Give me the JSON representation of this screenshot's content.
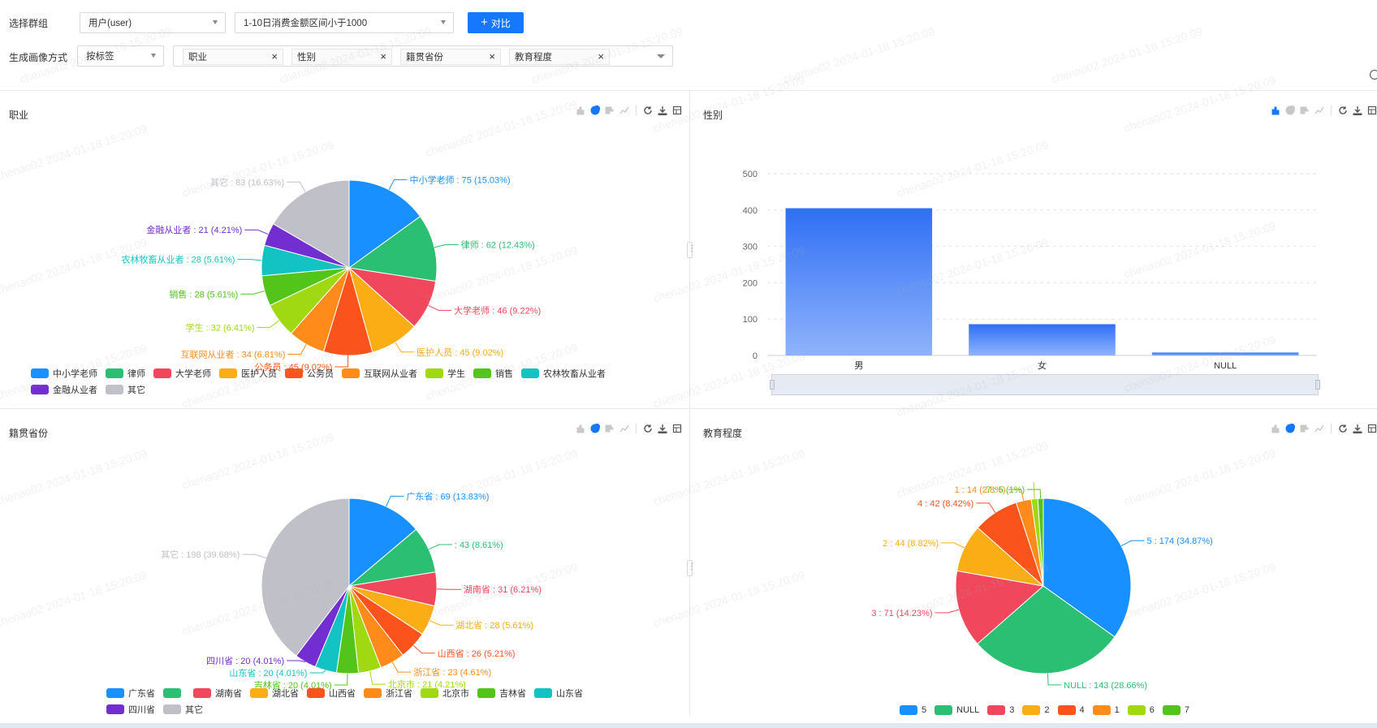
{
  "filters": {
    "group_label": "选择群组",
    "group_select": "用户(user)",
    "condition_select": "1-10日消费金额区间小于1000",
    "compare_label": "对比",
    "method_label": "生成画像方式",
    "method_select": "按标签",
    "tags": [
      "职业",
      "性别",
      "籍贯省份",
      "教育程度"
    ]
  },
  "watermark": "chenao02 2024-01-18 15:20:09",
  "panels": {
    "occupation": {
      "title": "职业"
    },
    "gender": {
      "title": "性别"
    },
    "province": {
      "title": "籍贯省份"
    },
    "education": {
      "title": "教育程度"
    }
  },
  "icons": [
    "bar-chart-icon",
    "pie-chart-icon",
    "horizontal-bar-icon",
    "line-chart-icon",
    "refresh-icon",
    "download-icon",
    "table-view-icon"
  ],
  "colors": {
    "accent": "#1677ff",
    "palette": [
      "#1890ff",
      "#2bbf74",
      "#f0475c",
      "#faad14",
      "#fa541c",
      "#ff8c1a",
      "#a0d911",
      "#52c41a",
      "#13c2c2",
      "#722ed1",
      "#c0c0c9"
    ]
  },
  "chart_data": [
    {
      "type": "pie",
      "title": "职业",
      "categories": [
        "中小学老师",
        "律师",
        "大学老师",
        "医护人员",
        "公务员",
        "互联网从业者",
        "学生",
        "销售",
        "农林牧畜从业者",
        "金融从业者",
        "其它"
      ],
      "values": [
        75,
        62,
        46,
        45,
        45,
        34,
        32,
        28,
        28,
        21,
        83
      ],
      "labels": [
        "中小学老师 : 75 (15.03%)",
        "律师 : 62 (12.43%)",
        "大学老师 : 46 (9.22%)",
        "医护人员 : 45 (9.02%)",
        "公务员 : 45 (9.02%)",
        "互联网从业者 : 34 (6.81%)",
        "学生 : 32 (6.41%)",
        "销售 : 28 (5.61%)",
        "农林牧畜从业者 : 28 (5.61%)",
        "金融从业者 : 21 (4.21%)",
        "其它 : 83 (16.63%)"
      ],
      "legend": [
        "中小学老师",
        "律师",
        "大学老师",
        "医护人员",
        "公务员",
        "互联网从业者",
        "学生",
        "销售",
        "农林牧畜从业者",
        "金融从业者",
        "其它"
      ],
      "legend_position": "bottom"
    },
    {
      "type": "bar",
      "title": "性别",
      "categories": [
        "男",
        "女",
        "NULL"
      ],
      "values": [
        405,
        86,
        8
      ],
      "ylim": [
        0,
        500
      ],
      "yticks": [
        0,
        100,
        200,
        300,
        400,
        500
      ],
      "grid": true
    },
    {
      "type": "pie",
      "title": "籍贯省份",
      "categories": [
        "广东省",
        "",
        "湖南省",
        "湖北省",
        "山西省",
        "浙江省",
        "北京市",
        "吉林省",
        "山东省",
        "四川省",
        "其它"
      ],
      "values": [
        69,
        43,
        31,
        28,
        26,
        23,
        21,
        20,
        20,
        20,
        198
      ],
      "labels": [
        "广东省 : 69 (13.83%)",
        " : 43 (8.61%)",
        "湖南省 : 31 (6.21%)",
        "湖北省 : 28 (5.61%)",
        "山西省 : 26 (5.21%)",
        "浙江省 : 23 (4.61%)",
        "北京市 : 21 (4.21%)",
        "吉林省 : 20 (4.01%)",
        "山东省 : 20 (4.01%)",
        "四川省 : 20 (4.01%)",
        "其它 : 198 (39.68%)"
      ],
      "legend": [
        "广东省",
        "",
        "湖南省",
        "湖北省",
        "山西省",
        "浙江省",
        "北京市",
        "吉林省",
        "山东省",
        "四川省",
        "其它"
      ],
      "legend_position": "bottom"
    },
    {
      "type": "pie",
      "title": "教育程度",
      "categories": [
        "5",
        "NULL",
        "3",
        "2",
        "4",
        "1",
        "6",
        "7"
      ],
      "values": [
        174,
        143,
        71,
        44,
        42,
        14,
        6,
        5
      ],
      "labels": [
        "5 : 174 (34.87%)",
        "NULL : 143 (28.66%)",
        "3 : 71 (14.23%)",
        "2 : 44 (8.82%)",
        "4 : 42 (8.42%)",
        "1 : 14 (2.8%)",
        "6 : 6 (1.2%)",
        "7 : 5 (1%)"
      ],
      "legend": [
        "5",
        "NULL",
        "3",
        "2",
        "4",
        "1",
        "6",
        "7"
      ],
      "legend_position": "bottom"
    }
  ]
}
